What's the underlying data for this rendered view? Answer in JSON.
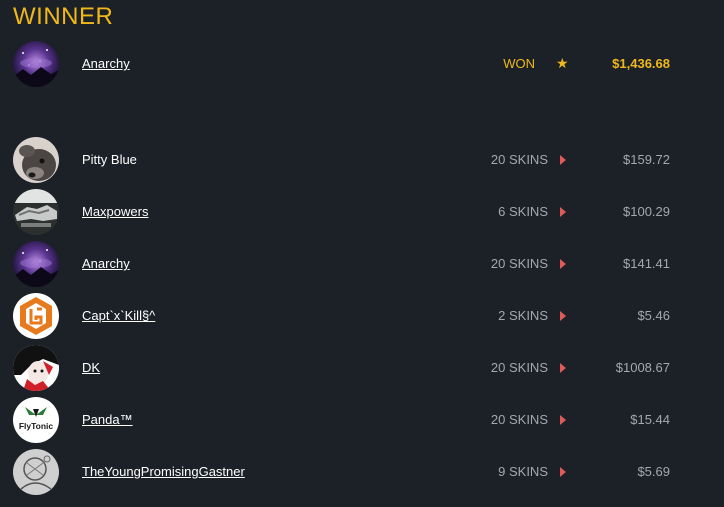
{
  "winner": {
    "title": "WINNER",
    "name": "Anarchy",
    "status": "WON",
    "star_icon": "star-icon",
    "amount": "$1,436.68",
    "avatar_icon": "galaxy-avatar-icon"
  },
  "players": [
    {
      "name": "Pitty Blue",
      "skins": "20 SKINS",
      "value": "$159.72",
      "linked": false,
      "avatar_icon": "dog-avatar-icon"
    },
    {
      "name": "Maxpowers",
      "skins": "6 SKINS",
      "value": "$100.29",
      "linked": true,
      "avatar_icon": "titan-avatar-icon"
    },
    {
      "name": "Anarchy",
      "skins": "20 SKINS",
      "value": "$141.41",
      "linked": true,
      "avatar_icon": "galaxy-avatar-icon"
    },
    {
      "name": "Capt`x`Kill§^",
      "skins": "2 SKINS",
      "value": "$5.46",
      "linked": true,
      "avatar_icon": "orange-logo-avatar-icon"
    },
    {
      "name": "DK",
      "skins": "20 SKINS",
      "value": "$1008.67",
      "linked": true,
      "avatar_icon": "red-portrait-avatar-icon"
    },
    {
      "name": "Panda™",
      "skins": "20 SKINS",
      "value": "$15.44",
      "linked": true,
      "avatar_icon": "flytonic-avatar-icon"
    },
    {
      "name": "TheYoungPromisingGastner",
      "skins": "9 SKINS",
      "value": "$5.69",
      "linked": true,
      "avatar_icon": "sketch-avatar-icon"
    }
  ],
  "flytonic_text": "FlyTonic",
  "colors": {
    "background": "#1b2127",
    "accent": "#f0b81a",
    "arrow": "#e05a5a",
    "muted": "#a3a8ad"
  }
}
